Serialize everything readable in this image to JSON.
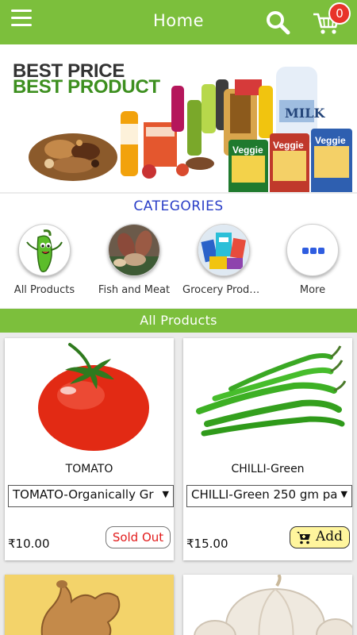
{
  "header": {
    "title": "Home",
    "cart_count": "0"
  },
  "banner": {
    "line1": "BEST PRICE",
    "line2": "BEST PRODUCT",
    "brand_text_1": "Veggie",
    "brand_text_2": "Veggie",
    "brand_text_3": "Veggie",
    "milk_text": "MILK"
  },
  "categories": {
    "title": "CATEGORIES",
    "items": [
      {
        "label": "All Products"
      },
      {
        "label": "Fish and Meat"
      },
      {
        "label": "Grocery Produ…"
      },
      {
        "label": "More"
      }
    ]
  },
  "section": {
    "title": "All Products"
  },
  "products": [
    {
      "name": "TOMATO",
      "variant": "TOMATO-Organically Gr",
      "price": "₹10.00",
      "status": "Sold Out"
    },
    {
      "name": "CHILLI-Green",
      "variant": "CHILLI-Green 250 gm pa",
      "price": "₹15.00",
      "action": "Add"
    }
  ],
  "colors": {
    "primary": "#7cbf3c",
    "badge": "#e8332a",
    "categories_title": "#2a3ec7",
    "sold_out": "#e21b1b",
    "add_button": "#fff59d"
  }
}
